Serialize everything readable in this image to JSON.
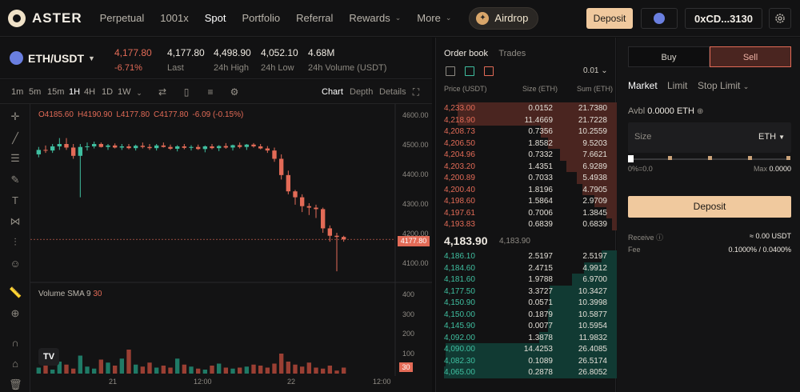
{
  "brand": {
    "name": "ASTER"
  },
  "nav": {
    "items": [
      {
        "label": "Perpetual",
        "active": false,
        "chevron": false
      },
      {
        "label": "1001x",
        "active": false,
        "chevron": false
      },
      {
        "label": "Spot",
        "active": true,
        "chevron": false
      },
      {
        "label": "Portfolio",
        "active": false,
        "chevron": false
      },
      {
        "label": "Referral",
        "active": false,
        "chevron": false
      },
      {
        "label": "Rewards",
        "active": false,
        "chevron": true
      },
      {
        "label": "More",
        "active": false,
        "chevron": true
      }
    ],
    "airdrop": "Airdrop",
    "deposit": "Deposit",
    "wallet": "0xCD...3130"
  },
  "ticker": {
    "pair": "ETH/USDT",
    "price": "4,177.80",
    "change": "-6.71%",
    "last_value": "4,177.80",
    "last_label": "Last",
    "high_value": "4,498.90",
    "high_label": "24h High",
    "low_value": "4,052.10",
    "low_label": "24h Low",
    "volume_value": "4.68M",
    "volume_label": "24h Volume (USDT)"
  },
  "chart": {
    "timeframes": [
      "1m",
      "5m",
      "15m",
      "1H",
      "4H",
      "1D",
      "1W"
    ],
    "active_timeframe": "1H",
    "tabs": [
      "Chart",
      "Depth",
      "Details"
    ],
    "active_tab": "Chart",
    "ohlc": [
      "O4185.60",
      "H4190.90",
      "L4177.80",
      "C4177.80",
      "-6.09 (-0.15%)"
    ],
    "volume_label": "Volume SMA 9",
    "volume_sma": "30",
    "current_price_tag": "4177.80",
    "volume_tag": "30",
    "tv_logo": "TV"
  },
  "chart_data": {
    "type": "candlestick",
    "price_ticks": [
      "4600.00",
      "4500.00",
      "4400.00",
      "4300.00",
      "4200.00",
      "4100.00"
    ],
    "volume_ticks": [
      "400",
      "300",
      "200",
      "100"
    ],
    "time_ticks": [
      "21",
      "12:00",
      "22",
      "12:00"
    ],
    "ylim": [
      4080,
      4620
    ],
    "candles": [
      [
        4465,
        4490,
        4455,
        4480
      ],
      [
        4480,
        4495,
        4470,
        4478
      ],
      [
        4478,
        4500,
        4470,
        4492
      ],
      [
        4492,
        4520,
        4480,
        4500
      ],
      [
        4500,
        4520,
        4480,
        4488
      ],
      [
        4488,
        4500,
        4450,
        4460
      ],
      [
        4460,
        4500,
        4320,
        4490
      ],
      [
        4490,
        4505,
        4478,
        4492
      ],
      [
        4492,
        4508,
        4485,
        4500
      ],
      [
        4500,
        4505,
        4488,
        4490
      ],
      [
        4490,
        4500,
        4480,
        4495
      ],
      [
        4495,
        4502,
        4485,
        4488
      ],
      [
        4488,
        4500,
        4480,
        4492
      ],
      [
        4492,
        4500,
        4482,
        4486
      ],
      [
        4486,
        4498,
        4478,
        4494
      ],
      [
        4494,
        4505,
        4485,
        4490
      ],
      [
        4490,
        4500,
        4480,
        4486
      ],
      [
        4486,
        4500,
        4478,
        4495
      ],
      [
        4495,
        4505,
        4488,
        4490
      ],
      [
        4490,
        4498,
        4480,
        4484
      ],
      [
        4484,
        4496,
        4475,
        4492
      ],
      [
        4492,
        4500,
        4482,
        4487
      ],
      [
        4487,
        4496,
        4478,
        4490
      ],
      [
        4490,
        4498,
        4480,
        4483
      ],
      [
        4483,
        4495,
        4472,
        4492
      ],
      [
        4492,
        4500,
        4482,
        4486
      ],
      [
        4486,
        4496,
        4476,
        4493
      ],
      [
        4493,
        4503,
        4484,
        4488
      ],
      [
        4488,
        4498,
        4478,
        4496
      ],
      [
        4496,
        4505,
        4485,
        4490
      ],
      [
        4490,
        4500,
        4480,
        4498
      ],
      [
        4498,
        4503,
        4488,
        4492
      ],
      [
        4492,
        4500,
        4482,
        4485
      ],
      [
        4485,
        4493,
        4470,
        4478
      ],
      [
        4478,
        4488,
        4440,
        4450
      ],
      [
        4450,
        4465,
        4380,
        4395
      ],
      [
        4395,
        4410,
        4330,
        4340
      ],
      [
        4340,
        4345,
        4295,
        4320
      ],
      [
        4320,
        4330,
        4270,
        4290
      ],
      [
        4290,
        4300,
        4260,
        4285
      ],
      [
        4285,
        4295,
        4250,
        4280
      ],
      [
        4280,
        4285,
        4200,
        4215
      ],
      [
        4215,
        4225,
        4170,
        4190
      ],
      [
        4190,
        4200,
        4070,
        4186
      ],
      [
        4186,
        4190,
        4170,
        4178
      ]
    ],
    "volumes": [
      30,
      55,
      20,
      60,
      45,
      25,
      90,
      35,
      25,
      70,
      55,
      40,
      75,
      120,
      45,
      35,
      55,
      30,
      40,
      30,
      75,
      45,
      35,
      25,
      20,
      40,
      50,
      30,
      25,
      30,
      35,
      45,
      40,
      30,
      50,
      100,
      60,
      45,
      35,
      55,
      30,
      25,
      40,
      15,
      30
    ]
  },
  "orderbook": {
    "tabs": [
      "Order book",
      "Trades"
    ],
    "active_tab": "Order book",
    "precision": "0.01",
    "head_price": "Price (USDT)",
    "head_size": "Size (ETH)",
    "head_sum": "Sum (ETH)",
    "asks": [
      {
        "price": "4,233.00",
        "size": "0.0152",
        "sum": "21.7380",
        "depth": 0.92
      },
      {
        "price": "4,218.90",
        "size": "11.4669",
        "sum": "21.7228",
        "depth": 0.92
      },
      {
        "price": "4,208.73",
        "size": "0.7356",
        "sum": "10.2559",
        "depth": 0.44
      },
      {
        "price": "4,206.50",
        "size": "1.8582",
        "sum": "9.5203",
        "depth": 0.4
      },
      {
        "price": "4,204.96",
        "size": "0.7332",
        "sum": "7.6621",
        "depth": 0.33
      },
      {
        "price": "4,203.20",
        "size": "1.4351",
        "sum": "6.9289",
        "depth": 0.29
      },
      {
        "price": "4,200.89",
        "size": "0.7033",
        "sum": "5.4938",
        "depth": 0.23
      },
      {
        "price": "4,200.40",
        "size": "1.8196",
        "sum": "4.7905",
        "depth": 0.2
      },
      {
        "price": "4,198.60",
        "size": "1.5864",
        "sum": "2.9709",
        "depth": 0.13
      },
      {
        "price": "4,197.61",
        "size": "0.7006",
        "sum": "1.3845",
        "depth": 0.06
      },
      {
        "price": "4,193.83",
        "size": "0.6839",
        "sum": "0.6839",
        "depth": 0.03
      }
    ],
    "mid_price": "4,183.90",
    "mid_sub": "4,183.90",
    "bids": [
      {
        "price": "4,186.10",
        "size": "2.5197",
        "sum": "2.5197",
        "depth": 0.09
      },
      {
        "price": "4,184.60",
        "size": "2.4715",
        "sum": "4.9912",
        "depth": 0.19
      },
      {
        "price": "4,181.60",
        "size": "1.9788",
        "sum": "6.9700",
        "depth": 0.26
      },
      {
        "price": "4,177.50",
        "size": "3.3727",
        "sum": "10.3427",
        "depth": 0.39
      },
      {
        "price": "4,150.90",
        "size": "0.0571",
        "sum": "10.3998",
        "depth": 0.39
      },
      {
        "price": "4,150.00",
        "size": "0.1879",
        "sum": "10.5877",
        "depth": 0.4
      },
      {
        "price": "4,145.90",
        "size": "0.0077",
        "sum": "10.5954",
        "depth": 0.4
      },
      {
        "price": "4,092.00",
        "size": "1.3878",
        "sum": "11.9832",
        "depth": 0.45
      },
      {
        "price": "4,090.00",
        "size": "14.4253",
        "sum": "26.4085",
        "depth": 0.99
      },
      {
        "price": "4,082.30",
        "size": "0.1089",
        "sum": "26.5174",
        "depth": 0.99
      },
      {
        "price": "4,065.00",
        "size": "0.2878",
        "sum": "26.8052",
        "depth": 1.0
      }
    ]
  },
  "trade": {
    "buy": "Buy",
    "sell": "Sell",
    "order_types": [
      "Market",
      "Limit",
      "Stop Limit"
    ],
    "active_type": "Market",
    "avbl_label": "Avbl",
    "avbl_value": "0.0000 ETH",
    "size_placeholder": "Size",
    "size_unit": "ETH",
    "slider_left": "0%=0.0",
    "slider_right_label": "Max",
    "slider_right_value": "0.0000",
    "deposit": "Deposit",
    "receive_label": "Receive",
    "receive_value": "≈ 0.00 USDT",
    "fee_label": "Fee",
    "fee_value": "0.1000% / 0.0400%"
  },
  "colors": {
    "up": "#3fbfa0",
    "down": "#e36b57",
    "accent": "#f0c99e"
  }
}
